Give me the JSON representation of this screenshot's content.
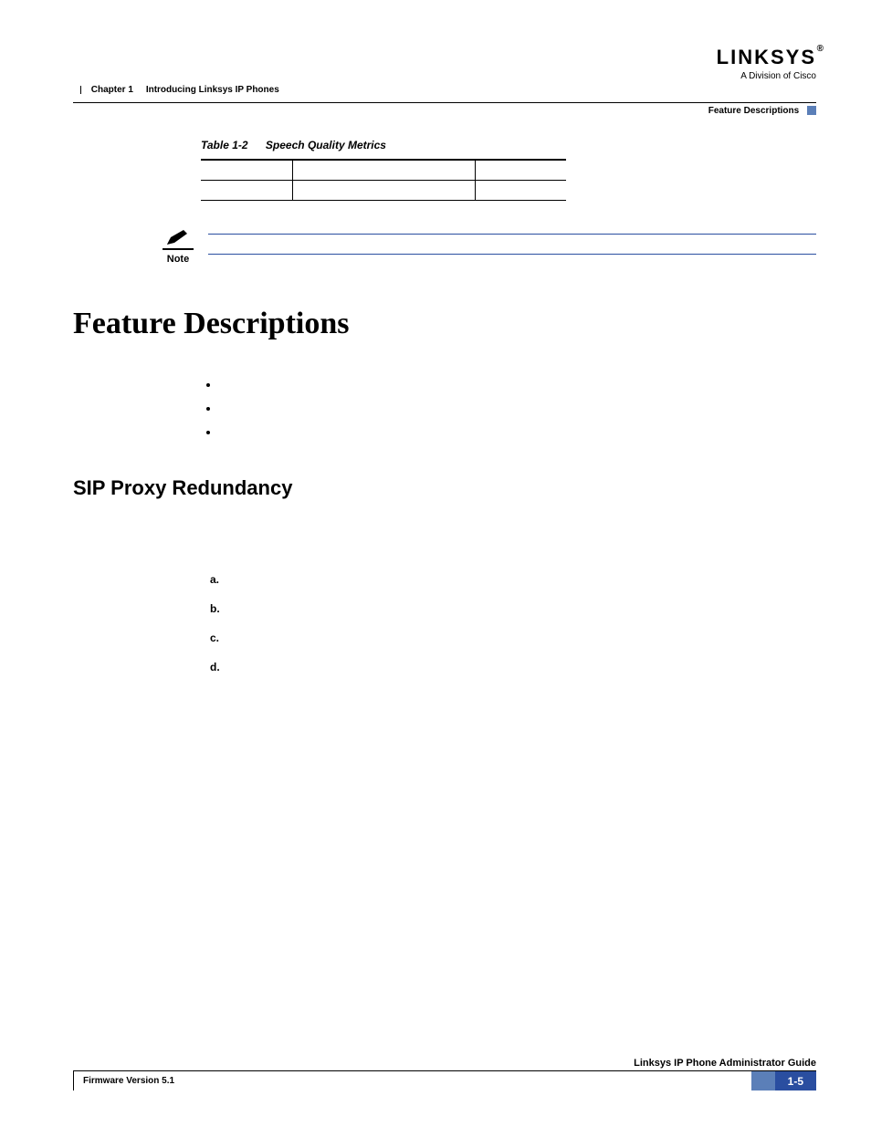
{
  "header": {
    "logo_main": "LINKSYS",
    "logo_sub": "A Division of Cisco",
    "chapter_label": "Chapter 1",
    "chapter_title": "Introducing Linksys IP Phones",
    "section_label": "Feature Descriptions"
  },
  "table": {
    "number": "Table 1-2",
    "title": "Speech Quality Metrics"
  },
  "note": {
    "label": "Note"
  },
  "heading1": "Feature Descriptions",
  "heading2": "SIP Proxy Redundancy",
  "ordered": {
    "a": "a.",
    "b": "b.",
    "c": "c.",
    "d": "d."
  },
  "footer": {
    "guide": "Linksys IP Phone Administrator Guide",
    "firmware": "Firmware Version 5.1",
    "page": "1-5"
  }
}
